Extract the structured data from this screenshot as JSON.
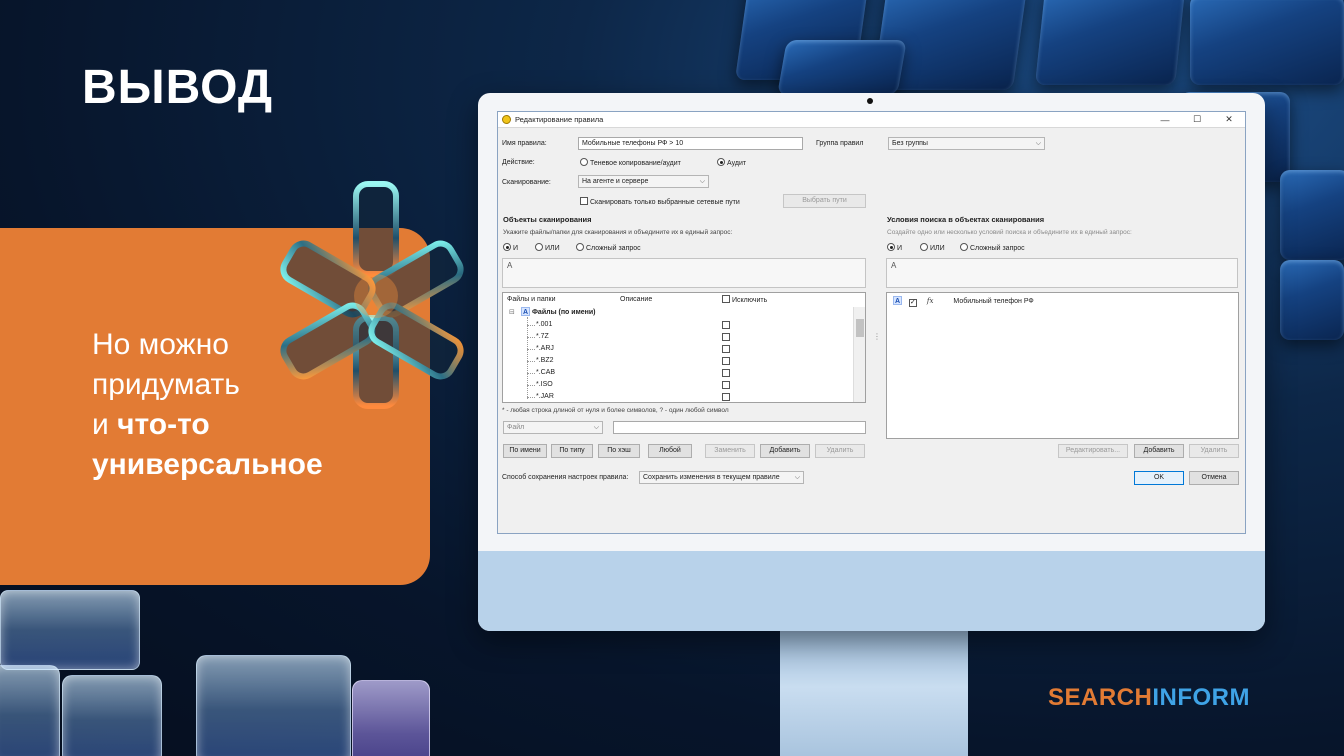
{
  "slide": {
    "heading": "ВЫВОД",
    "text_line1": "Но можно",
    "text_line2": "придумать",
    "text_line3_prefix": "и ",
    "text_line3_bold": "что-то",
    "text_line4_bold": "универсальное"
  },
  "logo": {
    "part1": "SEARCH",
    "part2": "INFORM"
  },
  "colors": {
    "accent_orange": "#e27b34",
    "logo_blue": "#3fa3e6",
    "background": "#07152b"
  },
  "dialog": {
    "title": "Редактирование правила",
    "rule_name_label": "Имя правила:",
    "rule_name_value": "Мобильные телефоны РФ > 10",
    "rule_group_label": "Группа правил",
    "rule_group_value": "Без группы",
    "action_label": "Действие:",
    "action_option1": "Теневое копирование/аудит",
    "action_option2": "Аудит",
    "scan_label": "Сканирование:",
    "scan_value": "На агенте и сервере",
    "scan_paths_only": "Сканировать только выбранные сетевые пути",
    "choose_paths_button": "Выбрать пути",
    "left": {
      "title": "Объекты сканирования",
      "hint": "Укажите файлы/папки для сканирования и объедините их в единый запрос:",
      "radio_and": "И",
      "radio_or": "ИЛИ",
      "radio_complex": "Сложный запрос",
      "query": "A",
      "col_files": "Файлы и папки",
      "col_description": "Описание",
      "col_exclude": "Исключить",
      "group_icon": "A",
      "group_label": "Файлы (по имени)",
      "items": [
        "*.001",
        "*.7Z",
        "*.ARJ",
        "*.BZ2",
        "*.CAB",
        "*.ISO",
        "*.JAR"
      ],
      "footnote": "* - любая строка длиной от нуля и более символов, ? - один любой символ",
      "file_type_value": "Файл",
      "buttons": {
        "by_name": "По имени",
        "by_type": "По типу",
        "by_hash": "По хэш",
        "any": "Любой",
        "replace": "Заменить",
        "add": "Добавить",
        "delete": "Удалить"
      }
    },
    "right": {
      "title": "Условия поиска в объектах сканирования",
      "hint": "Создайте одно или несколько условий поиска и объедините их в единый запрос:",
      "radio_and": "И",
      "radio_or": "ИЛИ",
      "radio_complex": "Сложный запрос",
      "query": "A",
      "row_icon": "A",
      "row_fx": "fx",
      "row_label": "Мобильный телефон РФ",
      "buttons": {
        "edit": "Редактировать...",
        "add": "Добавить",
        "delete": "Удалить"
      }
    },
    "save_method_label": "Способ сохранения настроек правила:",
    "save_method_value": "Сохранить изменения в текущем правиле",
    "ok_button": "OK",
    "cancel_button": "Отмена"
  }
}
